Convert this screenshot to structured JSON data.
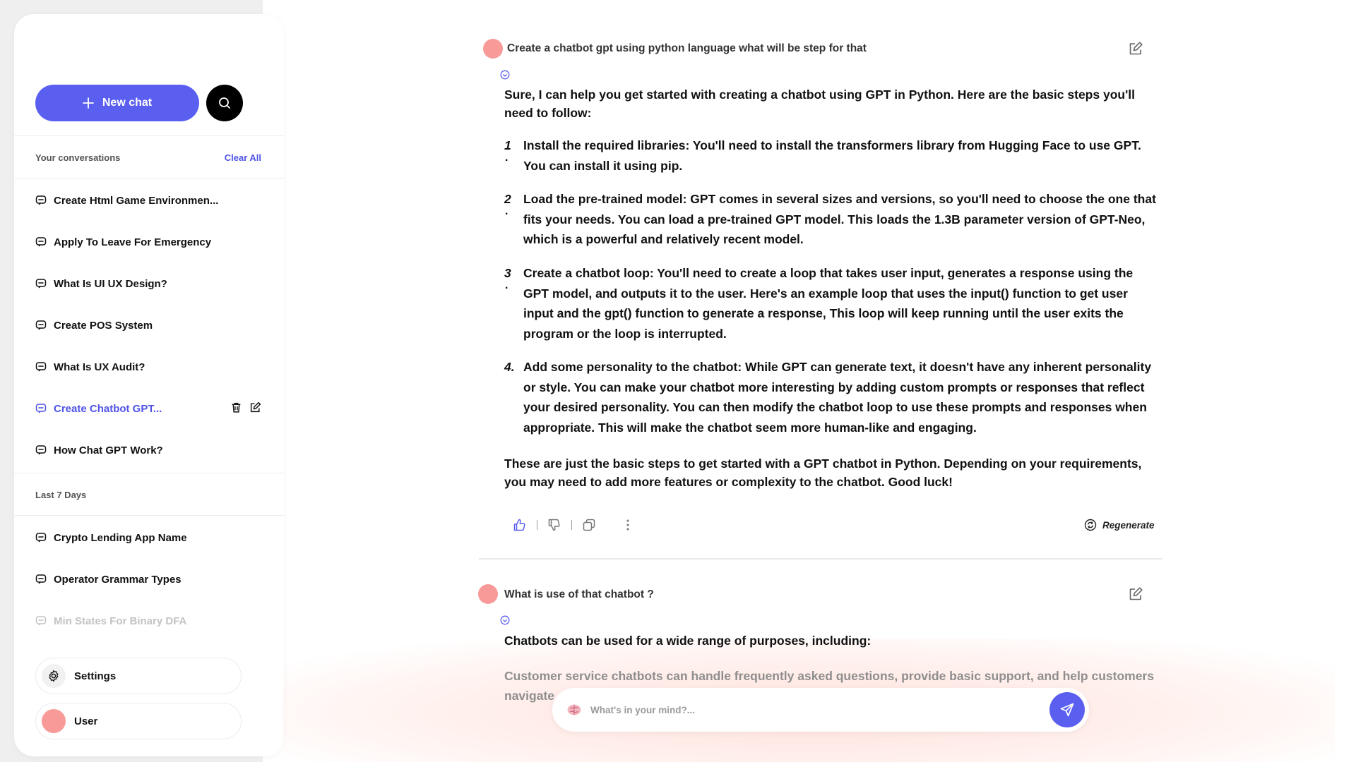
{
  "colors": {
    "accent": "#5b5ff0",
    "avatar": "#f79a98"
  },
  "sidebar": {
    "new_chat_label": "New chat",
    "conversations_header": "Your conversations",
    "clear_all_label": "Clear All",
    "recent_items": [
      {
        "label": "Create Html Game Environmen..."
      },
      {
        "label": "Apply To Leave For Emergency"
      },
      {
        "label": "What Is UI UX Design?"
      },
      {
        "label": "Create POS System"
      },
      {
        "label": "What Is UX Audit?"
      },
      {
        "label": "Create Chatbot GPT...",
        "active": true
      },
      {
        "label": "How Chat GPT Work?"
      }
    ],
    "last7_header": "Last 7 Days",
    "last7_items": [
      {
        "label": "Crypto Lending App Name"
      },
      {
        "label": "Operator Grammar Types"
      },
      {
        "label": "Min States For Binary DFA"
      }
    ],
    "settings_label": "Settings",
    "user_label": "User"
  },
  "chat": {
    "q1": "Create a chatbot gpt using python language what will be step for that",
    "a1_intro": "Sure, I can help you get started with creating a chatbot using GPT in Python. Here are the basic steps you'll need to follow:",
    "a1_steps": [
      {
        "num": "1",
        "text": "Install the required libraries: You'll need to install the transformers library from Hugging Face to use GPT. You can install it using pip."
      },
      {
        "num": "2",
        "text": "Load the pre-trained model: GPT comes in several sizes and versions, so you'll need to choose the one that fits your needs. You can load a pre-trained GPT model. This loads the 1.3B parameter version of GPT-Neo, which is a powerful and relatively recent model."
      },
      {
        "num": "3",
        "text": "Create a chatbot loop: You'll need to create a loop that takes user input, generates a response using the GPT model, and outputs it to the user. Here's an example loop that uses the input() function to get user input and the gpt() function to generate a response, This loop will keep running until the user exits the program or the loop is interrupted."
      },
      {
        "num": "4.",
        "text": "Add some personality to the chatbot: While GPT can generate text, it doesn't have any inherent personality or style. You can make your chatbot more interesting by adding custom prompts or responses that reflect your desired personality. You can then modify the chatbot loop to use these prompts and responses when appropriate. This will make the chatbot seem more human-like and engaging."
      }
    ],
    "a1_outro": "These are just the basic steps to get started with a GPT chatbot in Python. Depending on your requirements, you may need to add more features or complexity to the chatbot. Good luck!",
    "regenerate_label": "Regenerate",
    "q2": "What is use of that chatbot ?",
    "a2_intro": "Chatbots can be used for a wide range of purposes, including:",
    "a2_faded": "Customer service chatbots can handle frequently asked questions, provide basic support, and help customers navigate ... process."
  },
  "composer": {
    "placeholder": "What's in your mind?..."
  }
}
